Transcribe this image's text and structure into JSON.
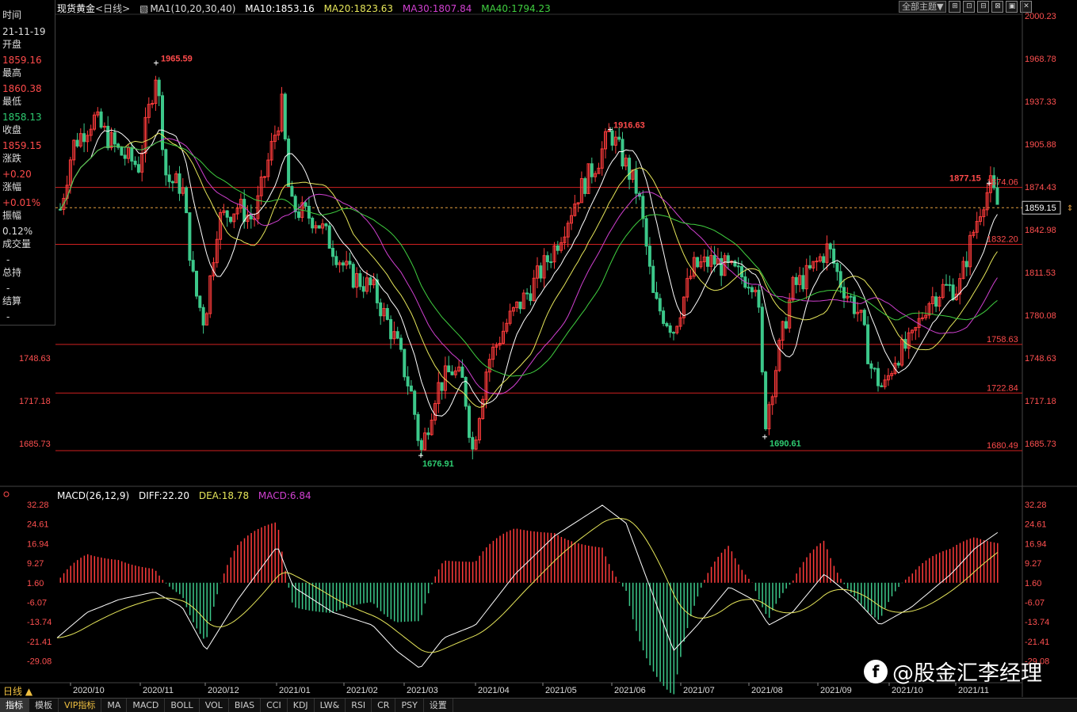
{
  "info_panel": {
    "time_label": "时间",
    "time_value": "21-11-19",
    "open_label": "开盘",
    "open_value": "1859.16",
    "high_label": "最高",
    "high_value": "1860.38",
    "low_label": "最低",
    "low_value": "1858.13",
    "close_label": "收盘",
    "close_value": "1859.15",
    "change_label": "涨跌",
    "change_value": "+0.20",
    "pct_label": "涨幅",
    "pct_value": "+0.01%",
    "amp_label": "振幅",
    "amp_value": "0.12%",
    "vol_label": "成交量",
    "vol_value": "-",
    "oi_label": "总持",
    "oi_value": "-",
    "settle_label": "结算",
    "settle_value": "-"
  },
  "header": {
    "instrument": "现货黄金",
    "period_tag": "<日线>",
    "ma_legend": "MA1(10,20,30,40)",
    "ma10": "MA10:1853.16",
    "ma20": "MA20:1823.63",
    "ma30": "MA30:1807.84",
    "ma40": "MA40:1794.23"
  },
  "toolbar": {
    "theme_label": "全部主题▼",
    "tools": [
      "⊞",
      "⊡",
      "⊟",
      "⊠",
      "▣",
      "✕"
    ]
  },
  "macd_header": {
    "params": "MACD(26,12,9)",
    "diff": "DIFF:22.20",
    "dea": "DEA:18.78",
    "macd": "MACD:6.84"
  },
  "price_axis": {
    "right_ticks": [
      "2000.23",
      "1968.78",
      "1937.33",
      "1905.88",
      "1874.43",
      "1842.98",
      "1811.53",
      "1780.08",
      "1748.63",
      "1717.18",
      "1685.73"
    ],
    "left_ticks": [
      "1748.63",
      "1717.18",
      "1685.73"
    ],
    "current_price": "1859.15"
  },
  "macd_axis": {
    "ticks": [
      "32.28",
      "24.61",
      "16.94",
      "9.27",
      "1.60",
      "-6.07",
      "-13.74",
      "-21.41",
      "-29.08"
    ]
  },
  "annotations": {
    "high_1": "1965.59",
    "low_1": "1676.91",
    "high_2": "1916.63",
    "low_2": "1690.61",
    "recent_high": "1877.15",
    "level_1874": "1874.06",
    "level_1832": "1832.20",
    "level_1758": "1758.63",
    "level_1722": "1722.84",
    "level_1680": "1680.49"
  },
  "x_axis": {
    "months": [
      "2020/10",
      "2020/11",
      "2020/12",
      "2021/01",
      "2021/02",
      "2021/03",
      "2021/04",
      "2021/05",
      "2021/06",
      "2021/07",
      "2021/08",
      "2021/09",
      "2021/10",
      "2021/11"
    ]
  },
  "period_button": "日线 ▲",
  "bottom_tabs": [
    "指标",
    "模板",
    "VIP指标",
    "MA",
    "MACD",
    "BOLL",
    "VOL",
    "BIAS",
    "CCI",
    "KDJ",
    "LW&",
    "RSI",
    "CR",
    "PSY",
    "设置"
  ],
  "watermark": "@股金汇李经理",
  "colors": {
    "up": "#ff3b3b",
    "down": "#3cc88a",
    "ma10": "#ffffff",
    "ma20": "#e6e65a",
    "ma30": "#d040d0",
    "ma40": "#40d040"
  },
  "chart_data": {
    "type": "candlestick",
    "ylim": [
      1670,
      2005
    ],
    "support_resistance": [
      1874.06,
      1832.2,
      1758.63,
      1722.84,
      1680.49
    ],
    "current_price": 1859.15,
    "macd_ylim": [
      -33,
      34
    ]
  }
}
